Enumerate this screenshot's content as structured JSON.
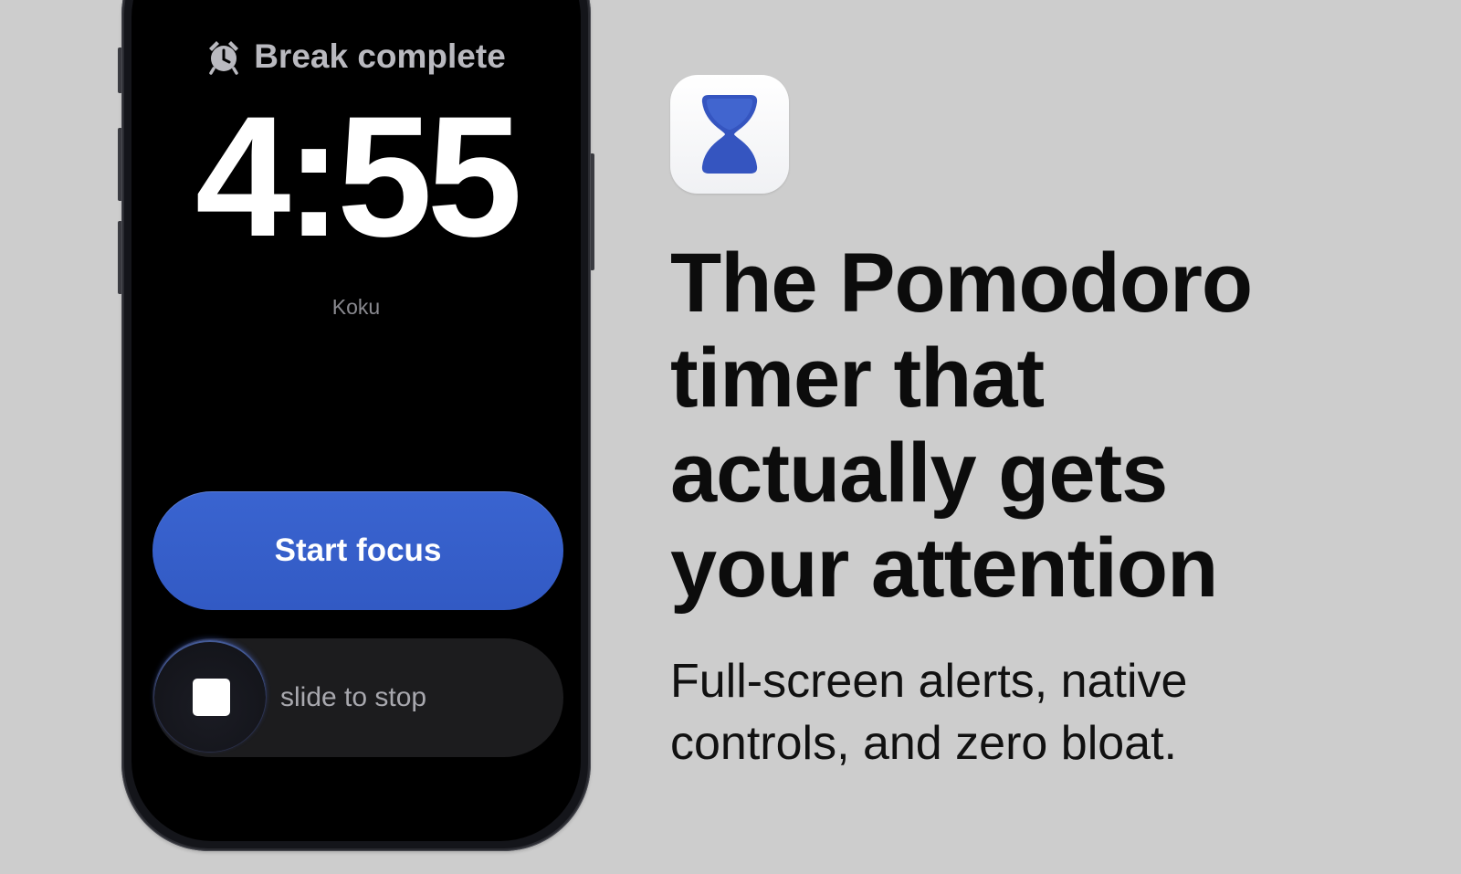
{
  "phone": {
    "alarm_status": "Break complete",
    "timer": "4:55",
    "subtitle": "Koku",
    "start_button_label": "Start focus",
    "slider_label": "slide to stop"
  },
  "promo": {
    "app_icon": "hourglass-icon",
    "headline_lines": [
      "The Pomodoro",
      "timer that",
      "actually gets",
      "your attention"
    ],
    "tagline_lines": [
      "Full-screen alerts, native",
      "controls, and zero bloat."
    ]
  },
  "colors": {
    "background": "#cdcdcd",
    "accent": "#3a5fc8",
    "screen": "#000000",
    "slider_track": "#1c1c1e"
  }
}
